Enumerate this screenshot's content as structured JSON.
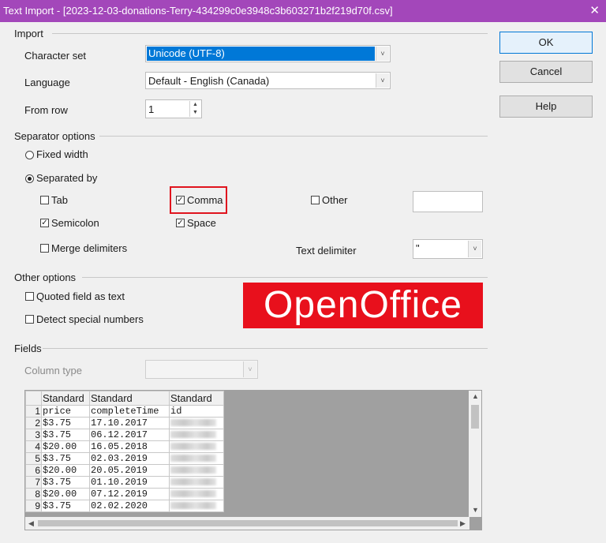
{
  "window": {
    "title": "Text Import - [2023-12-03-donations-Terry-434299c0e3948c3b603271b2f219d70f.csv]",
    "close_icon": "close-icon"
  },
  "import": {
    "section_label": "Import",
    "charset_label": "Character set",
    "charset_value": "Unicode (UTF-8)",
    "language_label": "Language",
    "language_value": "Default - English (Canada)",
    "from_row_label": "From row",
    "from_row_value": "1"
  },
  "separator": {
    "section_label": "Separator options",
    "fixed_width": "Fixed width",
    "separated_by": "Separated by",
    "separated_by_selected": true,
    "tab": "Tab",
    "tab_checked": false,
    "comma": "Comma",
    "comma_checked": true,
    "other": "Other",
    "other_checked": false,
    "semicolon": "Semicolon",
    "semicolon_checked": true,
    "space": "Space",
    "space_checked": true,
    "merge": "Merge delimiters",
    "merge_checked": false,
    "text_delimiter_label": "Text delimiter",
    "text_delimiter_value": "\""
  },
  "other_options": {
    "section_label": "Other options",
    "quoted": "Quoted field as text",
    "quoted_checked": false,
    "detect": "Detect special numbers",
    "detect_checked": false
  },
  "banner": {
    "text": "OpenOffice",
    "color": "#e8101c"
  },
  "fields": {
    "section_label": "Fields",
    "column_type_label": "Column type",
    "column_type_value": "",
    "columns": [
      "Standard",
      "Standard",
      "Standard"
    ],
    "rows": [
      {
        "n": "1",
        "c1": "price",
        "c2": "completeTime",
        "c3": "id"
      },
      {
        "n": "2",
        "c1": "$3.75",
        "c2": "17.10.2017",
        "c3": ""
      },
      {
        "n": "3",
        "c1": "$3.75",
        "c2": "06.12.2017",
        "c3": ""
      },
      {
        "n": "4",
        "c1": "$20.00",
        "c2": "16.05.2018",
        "c3": ""
      },
      {
        "n": "5",
        "c1": "$3.75",
        "c2": "02.03.2019",
        "c3": ""
      },
      {
        "n": "6",
        "c1": "$20.00",
        "c2": "20.05.2019",
        "c3": ""
      },
      {
        "n": "7",
        "c1": "$3.75",
        "c2": "01.10.2019",
        "c3": ""
      },
      {
        "n": "8",
        "c1": "$20.00",
        "c2": "07.12.2019",
        "c3": ""
      },
      {
        "n": "9",
        "c1": "$3.75",
        "c2": "02.02.2020",
        "c3": ""
      }
    ]
  },
  "buttons": {
    "ok": "OK",
    "cancel": "Cancel",
    "help": "Help"
  }
}
